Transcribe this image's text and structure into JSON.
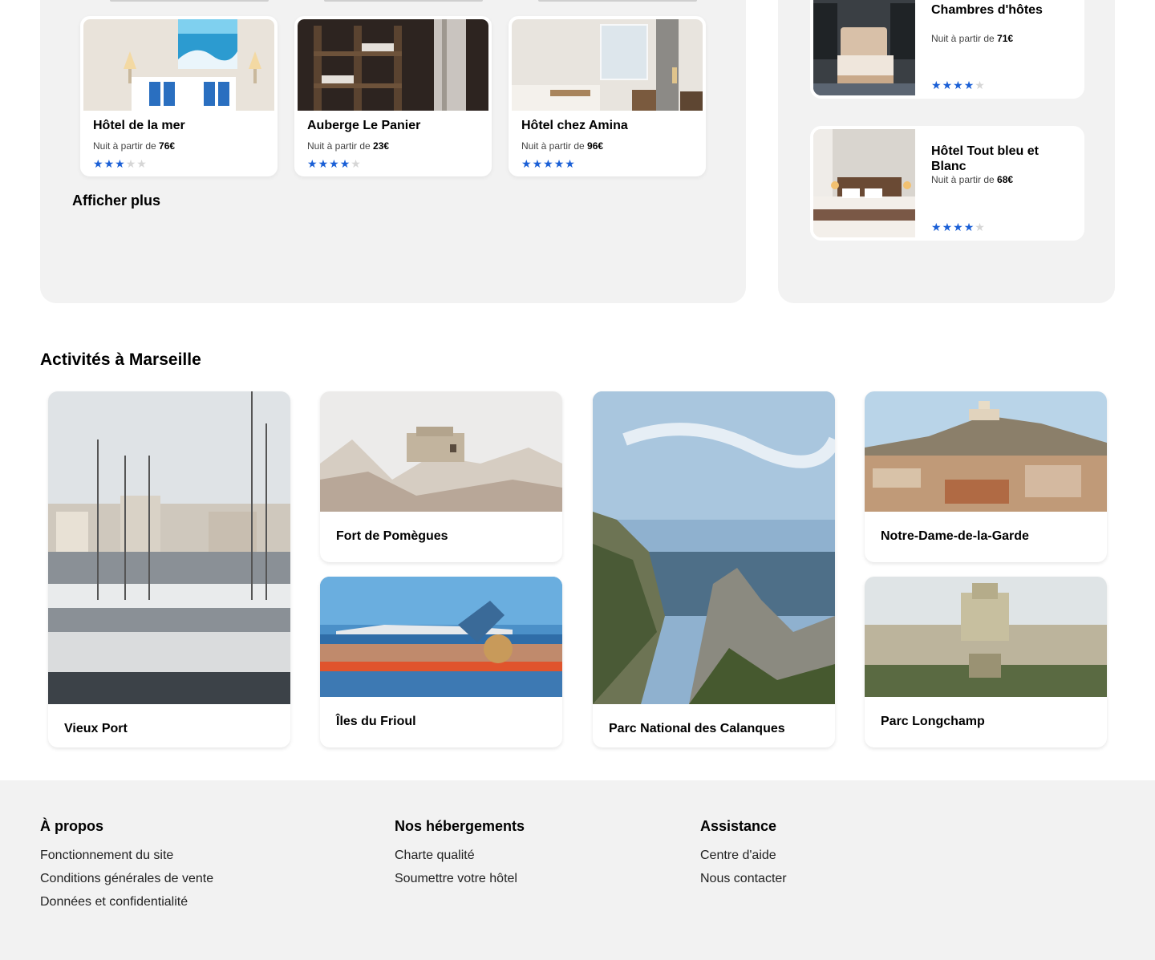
{
  "hotels": [
    {
      "name": "Hôtel de la mer",
      "price_prefix": "Nuit à partir de",
      "price": "76€",
      "rating": 3
    },
    {
      "name": "Auberge Le Panier",
      "price_prefix": "Nuit à partir de",
      "price": "23€",
      "rating": 4
    },
    {
      "name": "Hôtel chez Amina",
      "price_prefix": "Nuit à partir de",
      "price": "96€",
      "rating": 5
    }
  ],
  "show_more": "Afficher plus",
  "side_hotels": [
    {
      "name": "Au cœur de l'eau Chambres d'hôtes",
      "price_prefix": "Nuit à partir de",
      "price": "71€",
      "rating": 4
    },
    {
      "name": "Hôtel Tout bleu et Blanc",
      "price_prefix": "Nuit à partir de",
      "price": "68€",
      "rating": 4
    }
  ],
  "activities_title": "Activités à Marseille",
  "activities": [
    {
      "name": "Vieux Port"
    },
    {
      "name": "Fort de Pomègues"
    },
    {
      "name": "Îles du Frioul"
    },
    {
      "name": "Parc National des Calanques"
    },
    {
      "name": "Notre-Dame-de-la-Garde"
    },
    {
      "name": "Parc Longchamp"
    }
  ],
  "footer": {
    "about": {
      "title": "À propos",
      "links": [
        "Fonctionnement du site",
        "Conditions générales de vente",
        "Données et confidentialité"
      ]
    },
    "lodging": {
      "title": "Nos hébergements",
      "links": [
        "Charte qualité",
        "Soumettre votre hôtel"
      ]
    },
    "help": {
      "title": "Assistance",
      "links": [
        "Centre d'aide",
        "Nous contacter"
      ]
    }
  },
  "colors": {
    "star_on": "#1a5fd6",
    "star_off": "#d6d6d6",
    "panel_bg": "#f2f2f2"
  }
}
